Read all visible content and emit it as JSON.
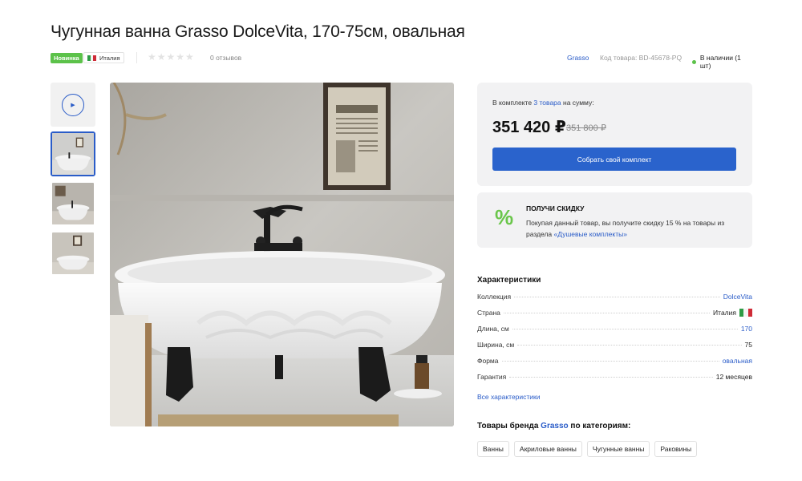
{
  "product": {
    "title": "Чугунная ванна Grasso DolceVita, 170-75см, овальная",
    "badge_new": "Новинка",
    "country": "Италия",
    "stars": "★★★★★",
    "reviews": "0 отзывов",
    "brand_link": "Grasso",
    "sku": "Код товара: BD-45678-PQ",
    "stock": "В наличии (1 шт)"
  },
  "kit": {
    "label_prefix": "В комплекте",
    "items_link": "3 товара",
    "label_suffix": "на сумму:",
    "price": "351 420 ₽",
    "old_price": "351 800 ₽",
    "button": "Собрать свой комплект"
  },
  "promo": {
    "icon": "%",
    "title": "ПОЛУЧИ СКИДКУ",
    "text": "Покупая данный товар, вы получите скидку 15 % на товары из раздела",
    "link": "«Душевые комплекты»"
  },
  "specs": {
    "title": "Характеристики",
    "rows": [
      {
        "key": "Коллекция",
        "value": "DolceVita"
      },
      {
        "key": "Страна",
        "value": "Италия"
      },
      {
        "key": "Длина, см",
        "value": "170"
      },
      {
        "key": "Ширина, см",
        "value": "75"
      },
      {
        "key": "Форма",
        "value": "овальная"
      },
      {
        "key": "Гарантия",
        "value": "12 месяцев"
      }
    ],
    "all_link": "Все характеристики"
  },
  "brand_categories": {
    "title_prefix": "Товары бренда",
    "brand": "Grasso",
    "title_suffix": "по категориям:",
    "items": [
      "Ванны",
      "Акриловые ванны",
      "Чугунные ванны",
      "Раковины"
    ]
  },
  "colors": {
    "accent": "#2a63cc",
    "badge_green": "#5cc24a",
    "flag_green": "#2e9b45",
    "flag_white": "#f4f4f4",
    "flag_red": "#cf2b37"
  },
  "icons": {
    "play": "play-icon",
    "discount": "percent-icon",
    "rating": "star-icon"
  }
}
